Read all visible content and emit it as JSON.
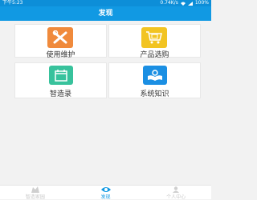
{
  "status": {
    "time": "下午5:23",
    "speed": "0.74K/s",
    "battery": "100%"
  },
  "header": {
    "title": "发现"
  },
  "cards": [
    {
      "label": "使用维护",
      "icon": "tools-icon",
      "color": "#f08a3c"
    },
    {
      "label": "产品选购",
      "icon": "shopping-cart-icon",
      "color": "#f2c422"
    },
    {
      "label": "智造录",
      "icon": "calendar-icon",
      "color": "#38c29c"
    },
    {
      "label": "系统知识",
      "icon": "book-icon",
      "color": "#1b8fe3"
    }
  ],
  "tabs": [
    {
      "label": "智造家园",
      "icon": "home-icon",
      "active": false
    },
    {
      "label": "发现",
      "icon": "eye-icon",
      "active": true
    },
    {
      "label": "个人中心",
      "icon": "person-icon",
      "active": false
    }
  ],
  "colors": {
    "accent": "#1199e3",
    "status_bar": "#0d8ed8"
  }
}
